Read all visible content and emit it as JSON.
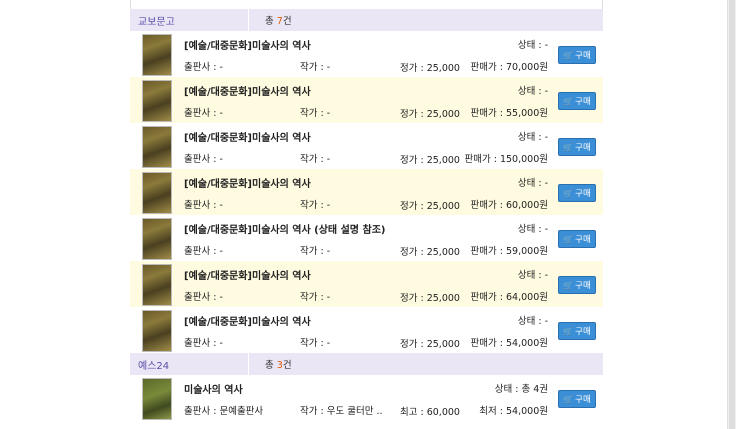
{
  "sections": [
    {
      "name": "교보문고",
      "count_prefix": "총 ",
      "count_value": "7",
      "count_suffix": "건",
      "items": [
        {
          "title": "[예술/대중문화]미술사의 역사",
          "state": "상태 : -",
          "publisher": "출판사 : -",
          "author": "작가 : -",
          "list_price": "정가 : 25,000",
          "sale_price": "판매가 : 70,000원"
        },
        {
          "title": "[예술/대중문화]미술사의 역사",
          "state": "상태 : -",
          "publisher": "출판사 : -",
          "author": "작가 : -",
          "list_price": "정가 : 25,000",
          "sale_price": "판매가 : 55,000원"
        },
        {
          "title": "[예술/대중문화]미술사의 역사",
          "state": "상태 : -",
          "publisher": "출판사 : -",
          "author": "작가 : -",
          "list_price": "정가 : 25,000",
          "sale_price": "판매가 : 150,000원"
        },
        {
          "title": "[예술/대중문화]미술사의 역사",
          "state": "상태 : -",
          "publisher": "출판사 : -",
          "author": "작가 : -",
          "list_price": "정가 : 25,000",
          "sale_price": "판매가 : 60,000원"
        },
        {
          "title": "[예술/대중문화]미술사의 역사 (상태 설명 참조)",
          "state": "상태 : -",
          "publisher": "출판사 : -",
          "author": "작가 : -",
          "list_price": "정가 : 25,000",
          "sale_price": "판매가 : 59,000원"
        },
        {
          "title": "[예술/대중문화]미술사의 역사",
          "state": "상태 : -",
          "publisher": "출판사 : -",
          "author": "작가 : -",
          "list_price": "정가 : 25,000",
          "sale_price": "판매가 : 64,000원"
        },
        {
          "title": "[예술/대중문화]미술사의 역사",
          "state": "상태 : -",
          "publisher": "출판사 : -",
          "author": "작가 : -",
          "list_price": "정가 : 25,000",
          "sale_price": "판매가 : 54,000원"
        }
      ]
    },
    {
      "name": "예스24",
      "count_prefix": "총 ",
      "count_value": "3",
      "count_suffix": "건",
      "items": [
        {
          "title": "미술사의 역사",
          "state": "상태 : 총 4권",
          "publisher": "출판사 : 문예출판사",
          "author": "작가 : 우도 쿨터만 ..",
          "list_price": "최고 : 60,000",
          "sale_price": "최저 : 54,000원"
        }
      ]
    }
  ],
  "buy_label": "구매",
  "buy_icon": "cart-icon",
  "colors": {
    "section_bg": "#ebe6f6",
    "alt_row": "#fffbe0",
    "buy_button": "#3b8fd6",
    "count_highlight": "#e05a00"
  }
}
